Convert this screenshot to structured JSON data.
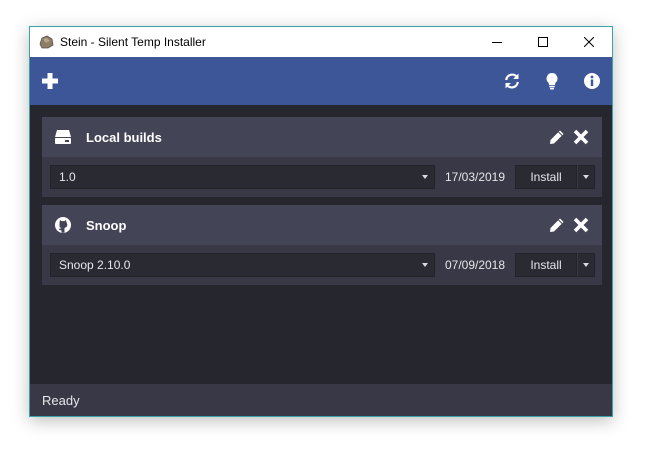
{
  "window": {
    "title": "Stein - Silent Temp Installer"
  },
  "toolbar": {
    "add_icon": "plus-icon",
    "refresh_icon": "refresh-icon",
    "tips_icon": "lightbulb-icon",
    "info_icon": "info-icon"
  },
  "sources": [
    {
      "name": "Local builds",
      "icon": "hard-drive-icon",
      "selected_version": "1.0",
      "date": "17/03/2019",
      "install_label": "Install"
    },
    {
      "name": "Snoop",
      "icon": "github-icon",
      "selected_version": "Snoop 2.10.0",
      "date": "07/09/2018",
      "install_label": "Install"
    }
  ],
  "status": {
    "text": "Ready"
  },
  "colors": {
    "toolbar": "#3d5697",
    "card_header": "#444457",
    "card_body": "#383846",
    "background": "#26262e",
    "accent_border": "#3aa3a8"
  }
}
